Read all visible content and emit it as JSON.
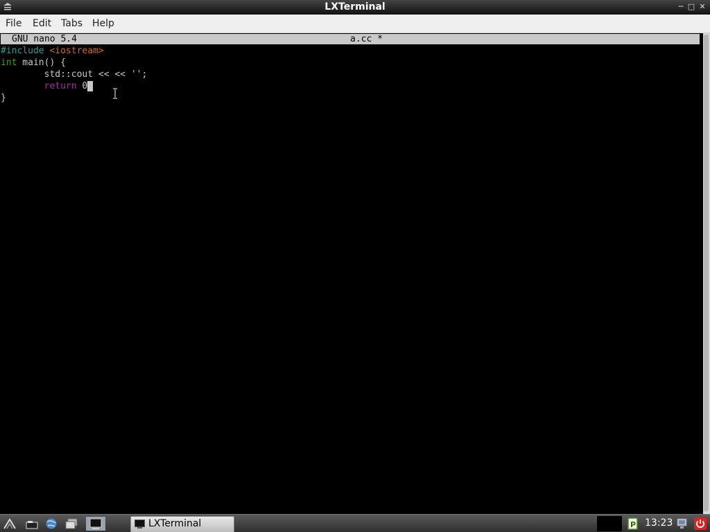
{
  "window": {
    "title": "LXTerminal",
    "controls": [
      "minimize-icon",
      "maximize-icon",
      "close-icon"
    ]
  },
  "menu": {
    "items": [
      {
        "label": "File"
      },
      {
        "label": "Edit"
      },
      {
        "label": "Tabs"
      },
      {
        "label": "Help"
      }
    ]
  },
  "nano": {
    "version": "GNU nano 5.4",
    "filename": "a.cc *"
  },
  "code": {
    "line1": {
      "directive": "#include",
      "header": "<iostream>"
    },
    "line2": {
      "type": "int",
      "rest": " main() {"
    },
    "line3": {
      "text": "        std::cout << << '';"
    },
    "line4": {
      "indent": "        ",
      "keyword": "return",
      "value": " 0"
    },
    "line5": {
      "text": "}"
    }
  },
  "colors": {
    "directive": "#2aa198",
    "header": "#d2691e",
    "type": "#3a9e3a",
    "keyword": "#a0309a",
    "text": "#c8c8c8"
  },
  "taskbar": {
    "launchers": [
      "start-menu-icon",
      "file-manager-icon",
      "browser-icon",
      "show-desktop-icon",
      "terminal-launcher-icon"
    ],
    "task_label": "LXTerminal",
    "clock": "13:23",
    "tray": [
      "pdf-icon",
      "network-icon",
      "power-icon"
    ]
  }
}
